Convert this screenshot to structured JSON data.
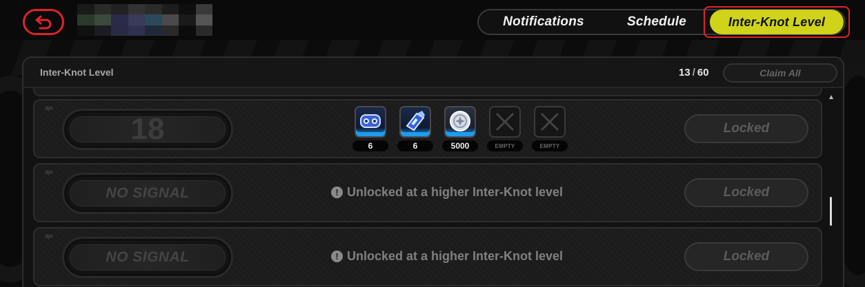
{
  "top_bar": {
    "back_icon": "back-arrow-icon",
    "username": ""
  },
  "tabs": [
    {
      "label": "Notifications",
      "active": false
    },
    {
      "label": "Schedule",
      "active": false
    },
    {
      "label": "Inter-Knot Level",
      "active": true
    }
  ],
  "colors": {
    "accent_yellow": "#cfd31a",
    "highlight_red": "#e0242a",
    "reward_blue": "#1e9cf0"
  },
  "panel": {
    "title": "Inter-Knot Level",
    "progress_current": "13",
    "progress_separator": "/",
    "progress_total": "60",
    "claim_all_label": "Claim All"
  },
  "rows": [
    {
      "logo": "ԠП",
      "level": "18",
      "rewards": [
        {
          "icon": "blue-gadget-icon",
          "count": "6"
        },
        {
          "icon": "blue-tool-icon",
          "count": "6"
        },
        {
          "icon": "silver-coin-icon",
          "count": "5000"
        },
        {
          "icon": "empty-slot-icon",
          "count": "EMPTY"
        },
        {
          "icon": "empty-slot-icon",
          "count": "EMPTY"
        }
      ],
      "button_label": "Locked"
    },
    {
      "logo": "ԠП",
      "level": "NO SIGNAL",
      "message": "Unlocked at a higher Inter-Knot level",
      "button_label": "Locked"
    },
    {
      "logo": "ԠП",
      "level": "NO SIGNAL",
      "message": "Unlocked at a higher Inter-Knot level",
      "button_label": "Locked"
    }
  ]
}
